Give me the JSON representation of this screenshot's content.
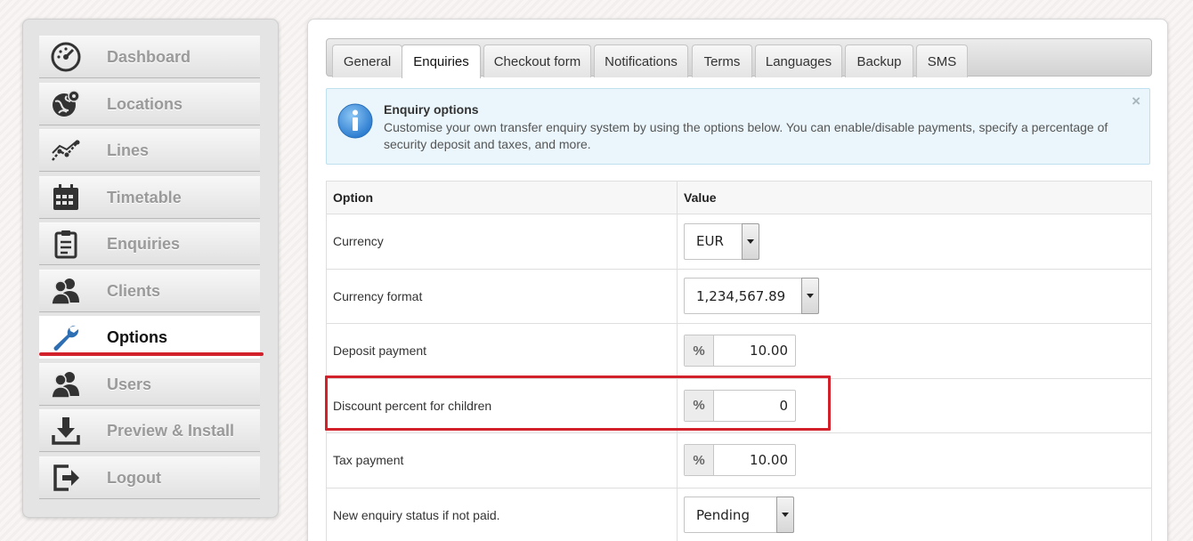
{
  "sidebar": {
    "items": [
      {
        "label": "Dashboard",
        "icon": "speedometer-icon"
      },
      {
        "label": "Locations",
        "icon": "globe-pin-icon"
      },
      {
        "label": "Lines",
        "icon": "line-graph-icon"
      },
      {
        "label": "Timetable",
        "icon": "calendar-icon"
      },
      {
        "label": "Enquiries",
        "icon": "clipboard-icon"
      },
      {
        "label": "Clients",
        "icon": "people-icon"
      },
      {
        "label": "Options",
        "icon": "wrench-icon"
      },
      {
        "label": "Users",
        "icon": "people-icon"
      },
      {
        "label": "Preview & Install",
        "icon": "download-icon"
      },
      {
        "label": "Logout",
        "icon": "logout-icon"
      }
    ],
    "active": "Options"
  },
  "tabs": [
    {
      "label": "General"
    },
    {
      "label": "Enquiries"
    },
    {
      "label": "Checkout form"
    },
    {
      "label": "Notifications"
    },
    {
      "label": "Terms"
    },
    {
      "label": "Languages"
    },
    {
      "label": "Backup"
    },
    {
      "label": "SMS"
    }
  ],
  "active_tab": "Enquiries",
  "info": {
    "title": "Enquiry options",
    "description": "Customise your own transfer enquiry system by using the options below. You can enable/disable payments, specify a percentage of security deposit and taxes, and more.",
    "close": "×"
  },
  "table": {
    "headers": {
      "option": "Option",
      "value": "Value"
    },
    "rows": [
      {
        "option": "Currency",
        "value": "EUR",
        "control": "select"
      },
      {
        "option": "Currency format",
        "value": "1,234,567.89",
        "control": "select"
      },
      {
        "option": "Deposit payment",
        "value": "10.00",
        "control": "percent",
        "symbol": "%"
      },
      {
        "option": "Discount percent for children",
        "value": "0",
        "control": "percent",
        "symbol": "%"
      },
      {
        "option": "Tax payment",
        "value": "10.00",
        "control": "percent",
        "symbol": "%"
      },
      {
        "option": "New enquiry status if not paid.",
        "value": "Pending",
        "control": "select"
      }
    ]
  },
  "colors": {
    "accent_red": "#d3212c",
    "info_bg": "#eaf6fb",
    "info_icon": "#3a8fd6"
  }
}
